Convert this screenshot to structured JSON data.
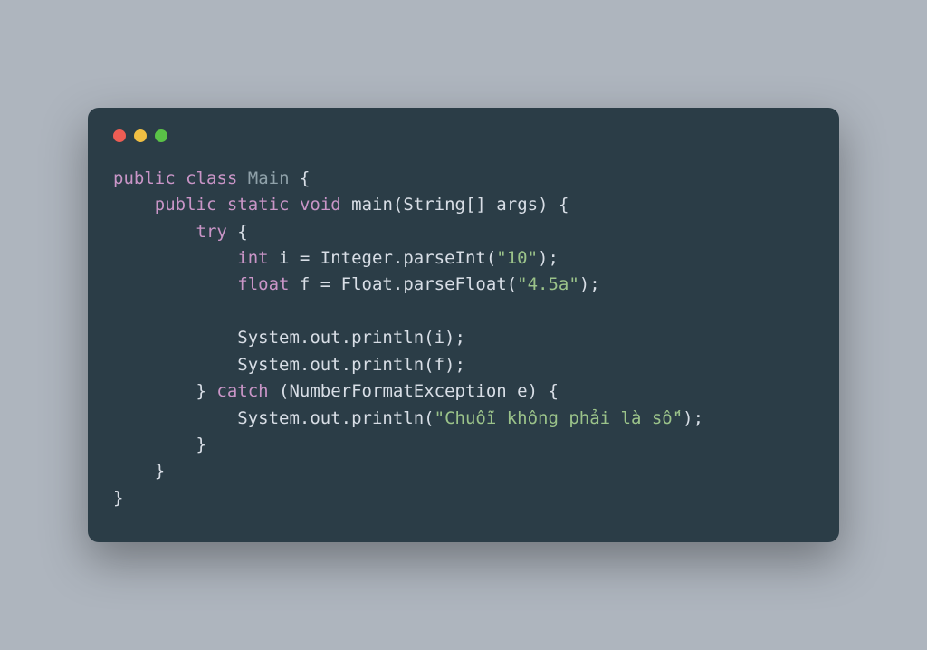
{
  "colors": {
    "bg": "#aeb5be",
    "window": "#2b3d47",
    "dot_red": "#ed5d54",
    "dot_yellow": "#f0bf43",
    "dot_green": "#5ac247",
    "keyword": "#c995c7",
    "classname": "#8fa1a9",
    "plain": "#d8dee6",
    "string": "#9bc38a"
  },
  "code": {
    "kw_public1": "public",
    "kw_class": "class",
    "cls_main": "Main",
    "brace_open1": " {",
    "indent1": "    ",
    "kw_public2": "public",
    "kw_static": "static",
    "kw_void": "void",
    "fn_main": " main",
    "sig_args": "(String[] args) {",
    "indent2": "        ",
    "kw_try": "try",
    "brace_open3": " {",
    "indent3": "            ",
    "kw_int": "int",
    "line_int": " i = Integer.parseInt(",
    "str_10": "\"10\"",
    "close_paren1": ");",
    "kw_float": "float",
    "line_float": " f = Float.parseFloat(",
    "str_45a": "\"4.5a\"",
    "close_paren2": ");",
    "blank": "",
    "println_i": "System.out.println(i);",
    "println_f": "System.out.println(f);",
    "brace_close_try": "} ",
    "kw_catch": "catch",
    "catch_sig": " (NumberFormatException e) {",
    "println_msg_open": "System.out.println(",
    "str_msg": "\"Chuỗi không phải là số\"",
    "println_msg_close": ");",
    "brace_close_catch": "}",
    "brace_close_method": "}",
    "brace_close_class": "}"
  }
}
